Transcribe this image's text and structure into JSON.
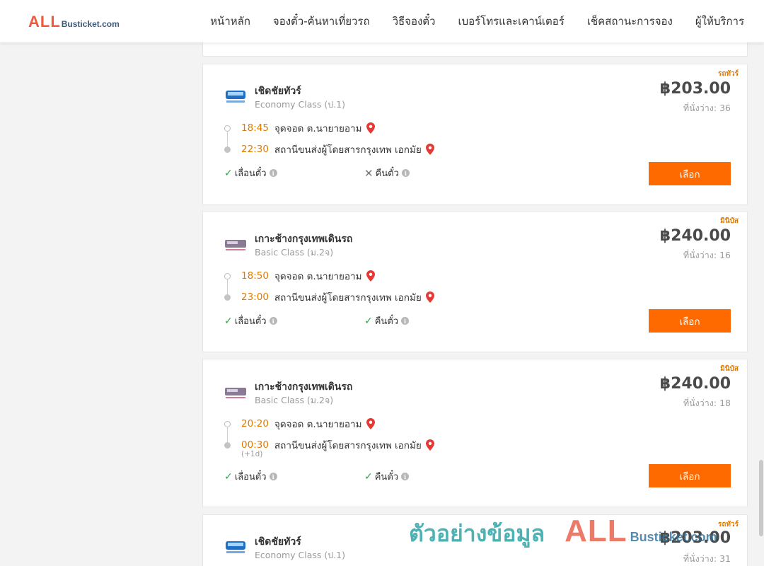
{
  "header": {
    "logo_all": "ALL",
    "logo_rest": "Busticket.com",
    "nav": [
      "หน้าหลัก",
      "จองตั๋ว-ค้นหาเที่ยวรถ",
      "วิธีจองตั๋ว",
      "เบอร์โทรและเคาน์เตอร์",
      "เช็คสถานะการจอง",
      "ผู้ให้บริการ"
    ]
  },
  "labels": {
    "reschedule": "เลื่อนตั๋ว",
    "refund": "คืนตั๋ว",
    "select": "เลือก",
    "seats_prefix": "ที่นั่งว่าง: "
  },
  "trips": [
    {
      "badge": "รถทัวร์",
      "operator": "เชิดชัยทัวร์",
      "bus_class": "Economy Class (ป.1)",
      "price": "฿203.00",
      "seats": "ที่นั่งว่าง: 36",
      "depart_time": "18:45",
      "depart_place": "จุดจอด ต.นายายอาม",
      "arrive_time": "22:30",
      "arrive_place": "สถานีขนส่งผู้โดยสารกรุงเทพ เอกมัย",
      "next_day": "",
      "reschedule": true,
      "refund": false
    },
    {
      "badge": "มินิบัส",
      "operator": "เกาะช้างกรุงเทพเดินรถ",
      "bus_class": "Basic Class (ม.2จ)",
      "price": "฿240.00",
      "seats": "ที่นั่งว่าง: 16",
      "depart_time": "18:50",
      "depart_place": "จุดจอด ต.นายายอาม",
      "arrive_time": "23:00",
      "arrive_place": "สถานีขนส่งผู้โดยสารกรุงเทพ เอกมัย",
      "next_day": "",
      "reschedule": true,
      "refund": true
    },
    {
      "badge": "มินิบัส",
      "operator": "เกาะช้างกรุงเทพเดินรถ",
      "bus_class": "Basic Class (ม.2จ)",
      "price": "฿240.00",
      "seats": "ที่นั่งว่าง: 18",
      "depart_time": "20:20",
      "depart_place": "จุดจอด ต.นายายอาม",
      "arrive_time": "00:30",
      "arrive_place": "สถานีขนส่งผู้โดยสารกรุงเทพ เอกมัย",
      "next_day": "(+1d)",
      "reschedule": true,
      "refund": true
    },
    {
      "badge": "รถทัวร์",
      "operator": "เชิดชัยทัวร์",
      "bus_class": "Economy Class (ป.1)",
      "price": "฿203.00",
      "seats": "ที่นั่งว่าง: 31"
    }
  ],
  "watermark": {
    "text": "ตัวอย่างข้อมูล",
    "all": "ALL",
    "rest": "Busticket.com"
  },
  "colors": {
    "accent": "#ff6a00",
    "time": "#e07b00",
    "ok": "#2aa844",
    "brand_red": "#f2593a",
    "brand_blue": "#3d5a7a"
  }
}
